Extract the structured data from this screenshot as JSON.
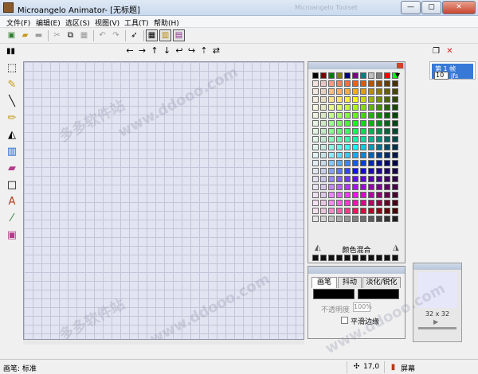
{
  "window": {
    "title": "Microangelo Animator- [无标题]",
    "faint_title": "Microangelo Toolset"
  },
  "window_buttons": [
    "—",
    "▢",
    "✕"
  ],
  "menu": [
    "文件(F)",
    "编辑(E)",
    "选区(S)",
    "视图(V)",
    "工具(T)",
    "帮助(H)"
  ],
  "toolbar_icons": [
    "new",
    "open",
    "save",
    "cut",
    "copy",
    "paste",
    "undo",
    "redo",
    "select",
    "grid-view",
    "frame-view",
    "animation-view"
  ],
  "transform_arrows": [
    "←",
    "→",
    "↑",
    "↓",
    "↩",
    "↪",
    "⇡",
    "⇄"
  ],
  "tools": [
    "marquee",
    "lasso-select",
    "line",
    "pencil",
    "fill",
    "gradient",
    "brush",
    "rectangle",
    "text",
    "eyedropper",
    "image-tool"
  ],
  "watermarks": [
    "多多软件站",
    "www.ddooo.com",
    "多多软件站",
    "www.ddooo.com",
    "www.ddooo.com"
  ],
  "palette": {
    "mix_label": "颜色混合",
    "top_row": [
      "#000000",
      "#800000",
      "#008000",
      "#808000",
      "#000080",
      "#800080",
      "#008080",
      "#c0c0c0",
      "#808080",
      "#ff0000",
      "#00ff00",
      "#ffff00",
      "#0000ff",
      "#ff00ff",
      "#00ffff",
      "#ffffff"
    ],
    "dropdown_glyph": "▼"
  },
  "brush": {
    "tabs": [
      "画笔",
      "抖动",
      "淡化/锐化"
    ],
    "opacity_label": "不透明度",
    "opacity_value": "100%",
    "smooth_label": "平滑边缘"
  },
  "frames": {
    "label": "第 1 帧",
    "number": "10",
    "fps": "jfs"
  },
  "preview": {
    "size": "32 x 32",
    "play": "▶"
  },
  "status": {
    "text": "画笔: 标准",
    "coord": "17,0",
    "mode": "屏幕"
  },
  "colors": {
    "accent": "#3879d8",
    "canvas": "#e2e4f1",
    "grid": "#c3c6d8"
  }
}
